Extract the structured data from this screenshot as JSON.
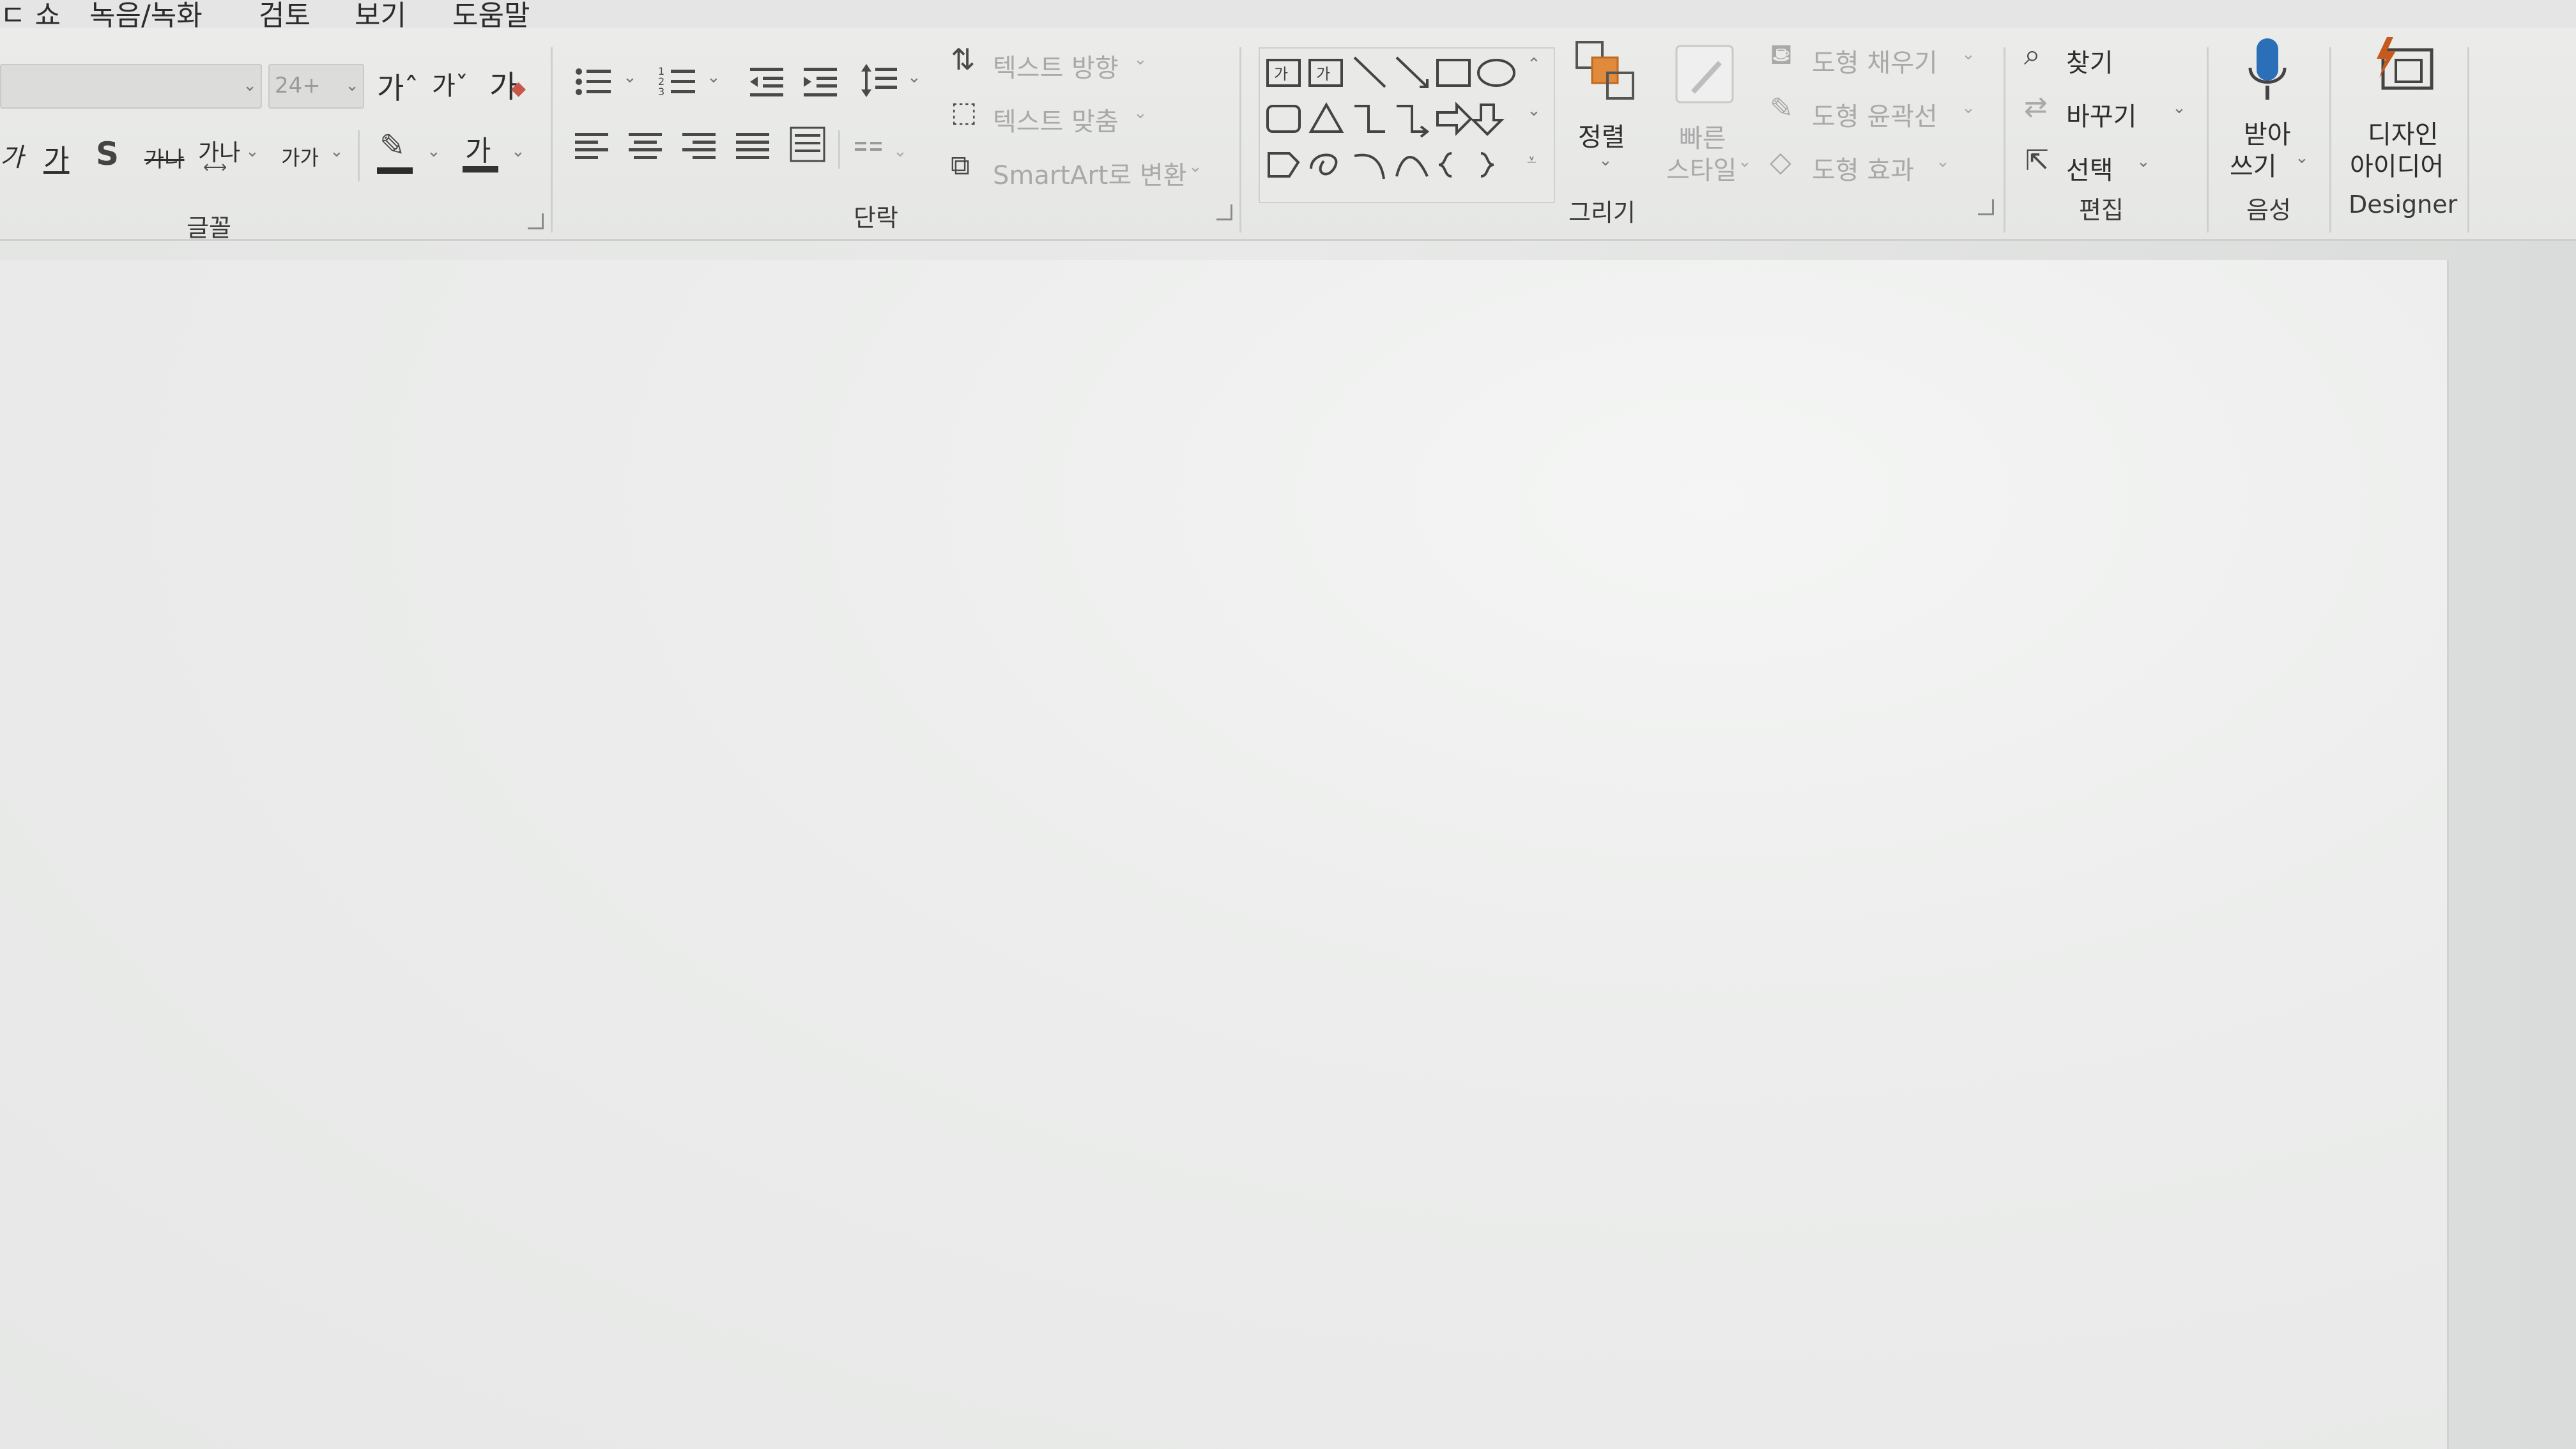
{
  "menu": {
    "items": [
      "ㄷ 쇼",
      "녹음/녹화",
      "검토",
      "보기",
      "도움말"
    ]
  },
  "font_group": {
    "label": "글꼴",
    "font_size_value": "24+",
    "grow_label": "가ˆ",
    "shrink_label": "가ˇ",
    "clear_label": "가",
    "italic_label": "가",
    "underline_label": "가",
    "shadow_label": "S",
    "strike_label": "가나",
    "spacing_label": "가나",
    "case_label": "가가",
    "font_color_label": "가"
  },
  "paragraph_group": {
    "label": "단락",
    "text_direction": "텍스트 방향",
    "align_text": "텍스트 맞춤",
    "smartart": "SmartArt로 변환"
  },
  "drawing_group": {
    "label": "그리기",
    "arrange": "정렬",
    "quick_styles_line1": "빠른",
    "quick_styles_line2": "스타일",
    "shape_fill": "도형 채우기",
    "shape_outline": "도형 윤곽선",
    "shape_effects": "도형 효과"
  },
  "editing_group": {
    "label": "편집",
    "find": "찾기",
    "replace": "바꾸기",
    "select": "선택"
  },
  "voice_group": {
    "label": "음성",
    "dictate_line1": "받아",
    "dictate_line2": "쓰기"
  },
  "designer_group": {
    "label": "Designer",
    "designer_line1": "디자인",
    "designer_line2": "아이디어"
  },
  "colors": {
    "highlight": "#2b2b2b",
    "font_color_bar": "#333333",
    "mic": "#2a6fb8",
    "designer": "#c65a1e",
    "arrange_orange": "#e08a3c"
  }
}
